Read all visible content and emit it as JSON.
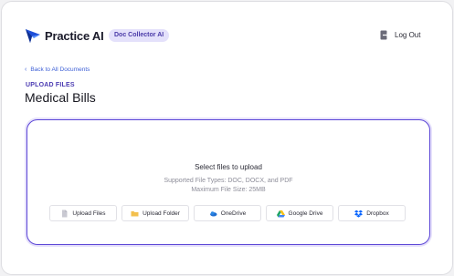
{
  "app": {
    "brand_name": "Practice AI",
    "product_badge": "Doc Collector AI"
  },
  "header": {
    "logout_label": "Log Out"
  },
  "nav": {
    "back_label": "Back to All Documents"
  },
  "page": {
    "section_label": "UPLOAD FILES",
    "title": "Medical Bills"
  },
  "upload": {
    "title": "Select files to upload",
    "supported_types": "Supported File Types: DOC, DOCX, and PDF",
    "max_size": "Maximum File Size: 25MB",
    "sources": [
      {
        "label": "Upload Files",
        "icon": "file-icon"
      },
      {
        "label": "Upload Folder",
        "icon": "folder-icon"
      },
      {
        "label": "OneDrive",
        "icon": "onedrive-icon"
      },
      {
        "label": "Google Drive",
        "icon": "google-drive-icon"
      },
      {
        "label": "Dropbox",
        "icon": "dropbox-icon"
      }
    ]
  },
  "colors": {
    "accent": "#5b45d6",
    "badge_bg": "#e4e1fb",
    "link": "#3d5fd6"
  }
}
